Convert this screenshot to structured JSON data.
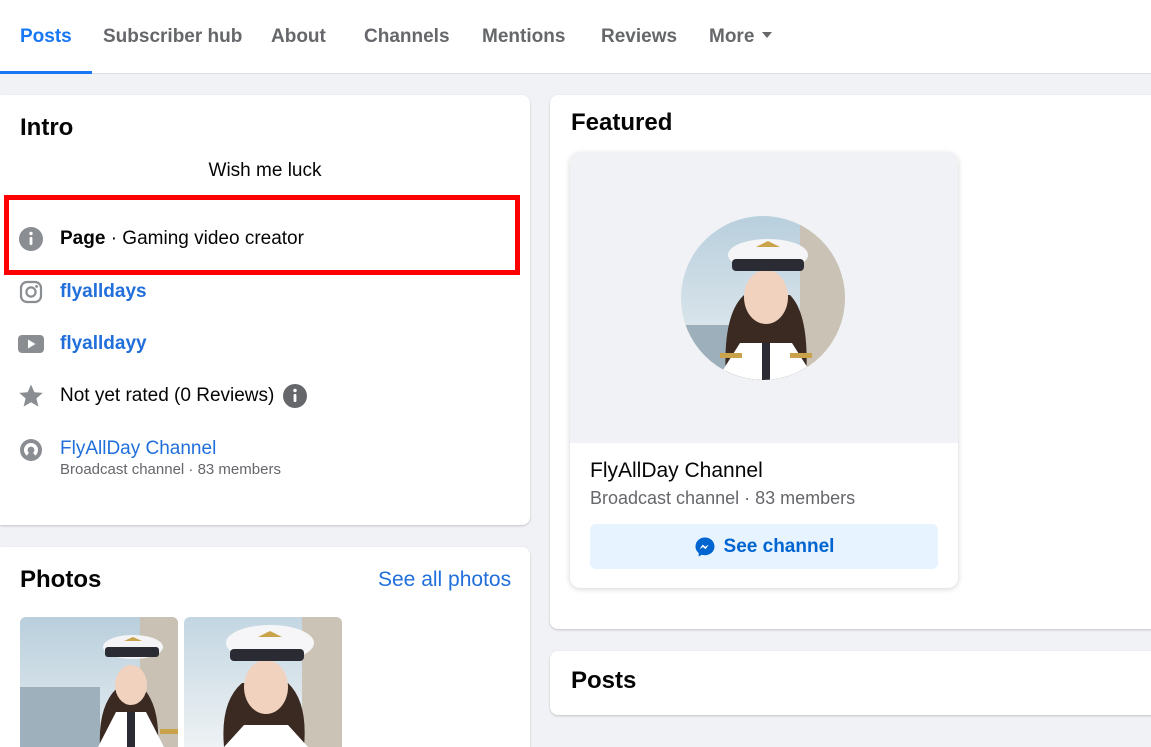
{
  "tabs": [
    {
      "label": "Posts",
      "active": true
    },
    {
      "label": "Subscriber hub"
    },
    {
      "label": "About"
    },
    {
      "label": "Channels"
    },
    {
      "label": "Mentions"
    },
    {
      "label": "Reviews"
    },
    {
      "label": "More"
    }
  ],
  "intro": {
    "title": "Intro",
    "bio": "Wish me luck",
    "category_label": "Page",
    "category_text": " · Gaming video creator",
    "instagram": "flyalldays",
    "youtube": "flyalldayy",
    "rating": "Not yet rated (0 Reviews)",
    "channel_name": "FlyAllDay Channel",
    "channel_sub": "Broadcast channel · 83 members"
  },
  "photos": {
    "title": "Photos",
    "see_all": "See all photos"
  },
  "featured": {
    "title": "Featured",
    "channel_name": "FlyAllDay Channel",
    "channel_sub": "Broadcast channel · 83 members",
    "button": "See channel"
  },
  "posts_section": {
    "title": "Posts"
  },
  "colors": {
    "accent": "#1877f2",
    "link": "#216fdb",
    "highlight_box": "#ff0000"
  },
  "icons": [
    "info-icon",
    "instagram-icon",
    "youtube-icon",
    "star-icon",
    "broadcast-icon",
    "messenger-icon",
    "caret-down-icon"
  ]
}
